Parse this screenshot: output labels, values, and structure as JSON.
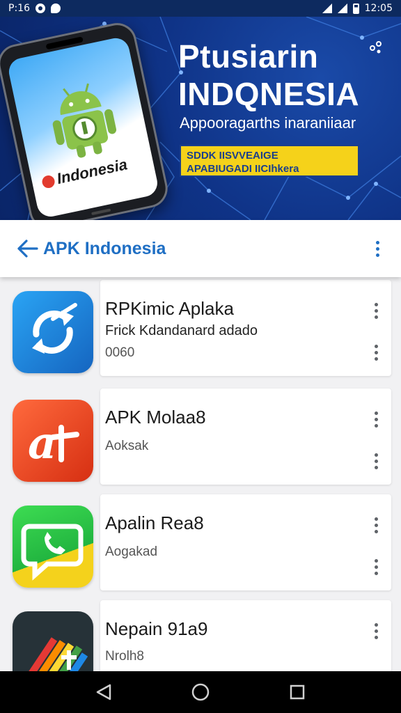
{
  "status_bar": {
    "time_left": "P:16",
    "time_right": "12:05"
  },
  "banner": {
    "phone_label": "Indonesia",
    "title_line1": "Ptusiarin",
    "title_line2": "INDQNESIA",
    "subtitle": "Appooragarths inaraniiaar",
    "box_line1": "SDDK IISVVEAIGE",
    "box_line2": "APABIUGADI IICIhkera"
  },
  "app_bar": {
    "title": "APK Indonesia"
  },
  "apps": [
    {
      "title": "RPKimic Aplaka",
      "subtitle": "Frick Kdandanard adado",
      "meta": "0060",
      "icon": "sync-arrows-icon",
      "color": "#1e88e5"
    },
    {
      "title": "APK Molaa8",
      "subtitle": "",
      "meta": "Aoksak",
      "icon": "letter-a-icon",
      "color": "#e53b1d"
    },
    {
      "title": "Apalin Rea8",
      "subtitle": "",
      "meta": "Aogakad",
      "icon": "chat-bubble-icon",
      "color": "#2ecc40"
    },
    {
      "title": "Nepain 91a9",
      "subtitle": "",
      "meta": "Nrolh8",
      "icon": "rainbow-stripes-icon",
      "color": "#263238"
    }
  ],
  "nav": {
    "back_icon": "triangle-back-icon",
    "home_icon": "circle-home-icon",
    "recents_icon": "square-recents-icon"
  }
}
